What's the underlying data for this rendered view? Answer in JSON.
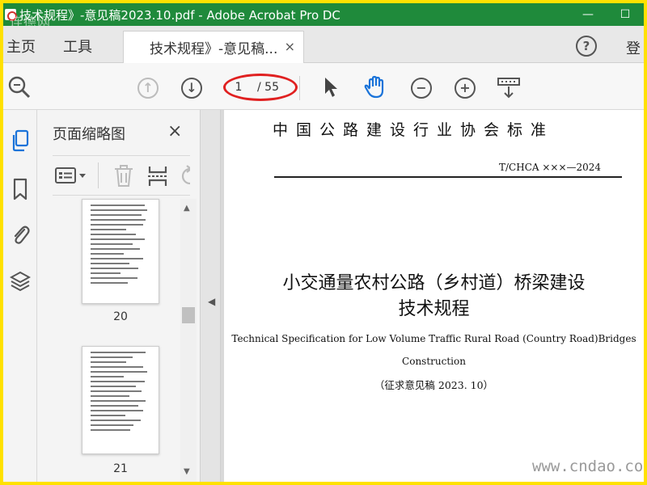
{
  "window": {
    "title": "技术规程》-意见稿2023.10.pdf - Adobe Acrobat Pro DC",
    "minimize": "—",
    "maximize": "☐"
  },
  "watermark_top": "连德网",
  "tabs": {
    "home": "主页",
    "tools": "工具",
    "document": "技术规程》-意见稿...",
    "close": "×",
    "help": "?",
    "login": "登"
  },
  "toolbar": {
    "current_page": "1",
    "total_pages": "/ 55"
  },
  "thumbnails": {
    "title": "页面缩略图",
    "close": "×",
    "pages": [
      {
        "label": "20"
      },
      {
        "label": "21"
      }
    ]
  },
  "document": {
    "organization": "中国公路建设行业协会标准",
    "standard_number": "T/CHCA ×××—2024",
    "title_cn_line1": "小交通量农村公路（乡村道）桥梁建设",
    "title_cn_line2": "技术规程",
    "title_en_line1": "Technical Specification for Low Volume Traffic Rural Road (Country Road)Bridges",
    "title_en_line2": "Construction",
    "draft_note": "（征求意见稿 2023. 10）"
  },
  "watermark_bottom": "www.cndao.com",
  "colors": {
    "titlebar": "#1f8a3b",
    "border": "#ffe100",
    "accent": "#1a73d9",
    "annotation": "#e02020"
  }
}
